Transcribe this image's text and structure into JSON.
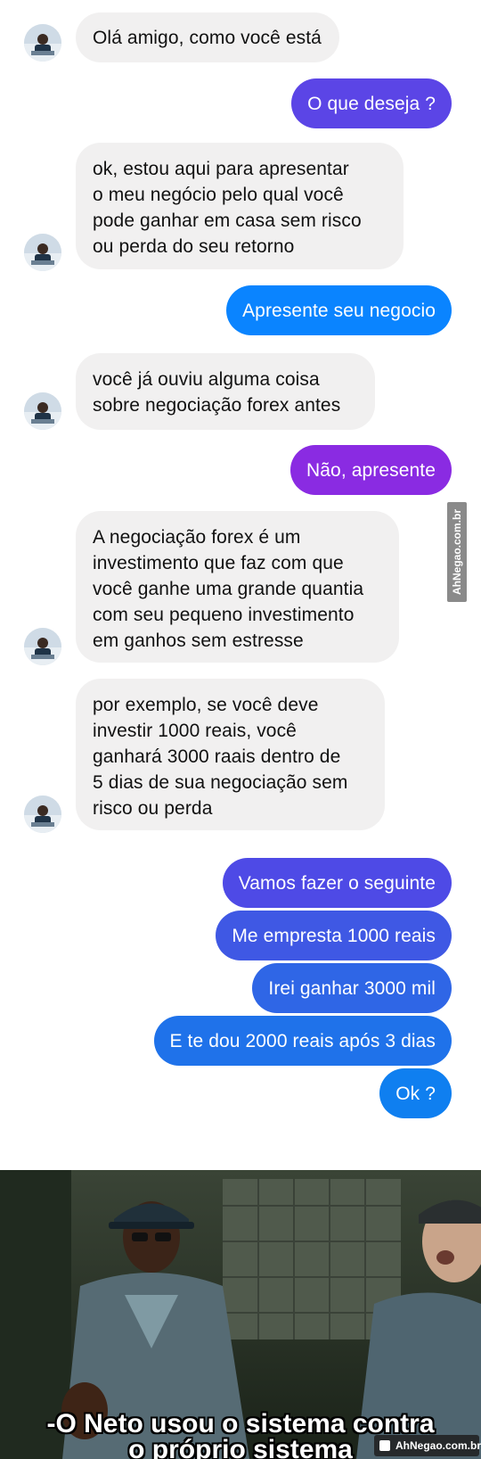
{
  "messages": {
    "m1": "Olá amigo, como você está",
    "m2": "O que deseja ?",
    "m3": "ok, estou aqui para apresentar\no meu negócio pelo qual você\npode ganhar em casa sem risco\nou perda do seu retorno",
    "m4": "Apresente seu negocio",
    "m5": "você já ouviu alguma coisa\nsobre negociação forex antes",
    "m6": "Não, apresente",
    "m7": "A negociação forex é um\ninvestimento que faz com que\nvocê ganhe uma grande quantia\ncom seu pequeno investimento\nem ganhos sem estresse",
    "m8": "por exemplo, se você deve\ninvestir 1000 reais, você\nganhará 3000 raais dentro de\n5 dias de sua negociação sem\nrisco ou perda",
    "m9": "Vamos fazer o seguinte",
    "m10": "Me empresta 1000 reais",
    "m11": "Irei ganhar 3000 mil",
    "m12": "E te dou 2000 reais após 3 dias",
    "m13": "Ok ?"
  },
  "watermark": {
    "side": "AhNegao.com.br",
    "bottom": "AhNegao.com.br"
  },
  "meme": {
    "subtitle_line1": "-O Neto usou o sistema contra",
    "subtitle_line2": "o próprio sistema"
  },
  "colors": {
    "incoming_bubble": "#f1f0f0",
    "outgoing_blue": "#0a84ff",
    "outgoing_purple": "#8a2be2",
    "outgoing_indigo": "#4452e0"
  }
}
